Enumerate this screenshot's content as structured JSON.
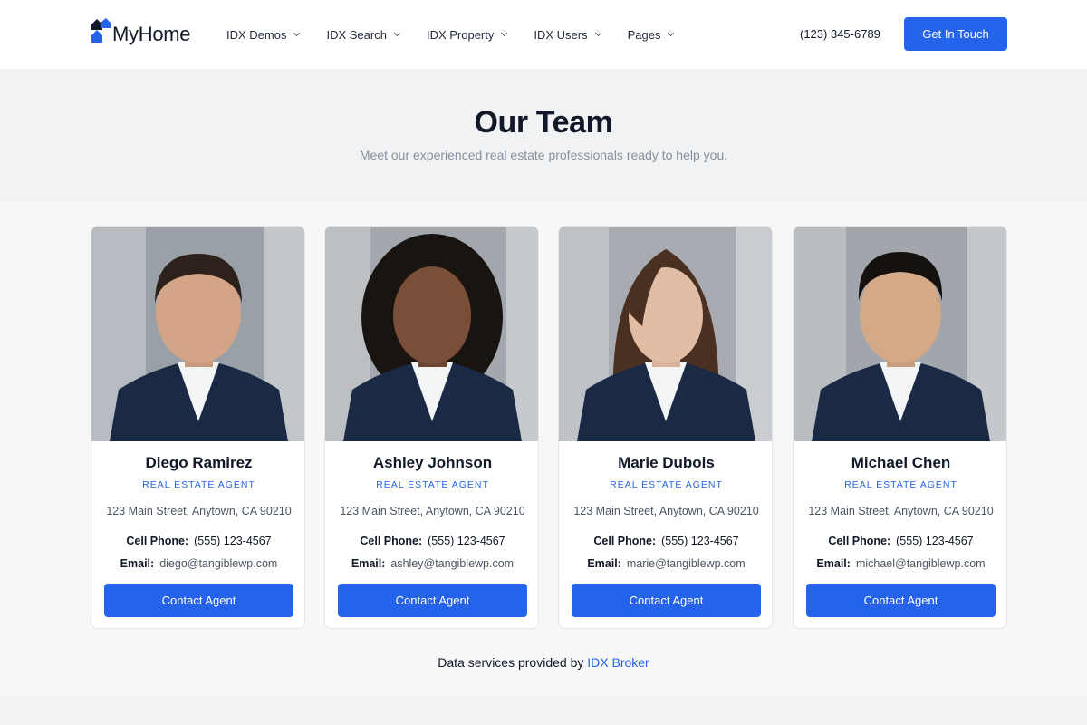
{
  "header": {
    "logo_text": "MyHome",
    "nav": [
      {
        "label": "IDX Demos"
      },
      {
        "label": "IDX Search"
      },
      {
        "label": "IDX Property"
      },
      {
        "label": "IDX Users"
      },
      {
        "label": "Pages"
      }
    ],
    "phone": "(123) 345-6789",
    "cta_label": "Get In Touch"
  },
  "hero": {
    "title": "Our Team",
    "subtitle": "Meet our experienced real estate professionals ready to help you."
  },
  "labels": {
    "cell_phone": "Cell Phone:",
    "email": "Email:",
    "contact_button": "Contact Agent"
  },
  "agents": [
    {
      "name": "Diego Ramirez",
      "role": "REAL ESTATE AGENT",
      "address": "123 Main Street, Anytown, CA 90210",
      "phone": "(555) 123-4567",
      "email": "diego@tangiblewp.com"
    },
    {
      "name": "Ashley Johnson",
      "role": "REAL ESTATE AGENT",
      "address": "123 Main Street, Anytown, CA 90210",
      "phone": "(555) 123-4567",
      "email": "ashley@tangiblewp.com"
    },
    {
      "name": "Marie Dubois",
      "role": "REAL ESTATE AGENT",
      "address": "123 Main Street, Anytown, CA 90210",
      "phone": "(555) 123-4567",
      "email": "marie@tangiblewp.com"
    },
    {
      "name": "Michael Chen",
      "role": "REAL ESTATE AGENT",
      "address": "123 Main Street, Anytown, CA 90210",
      "phone": "(555) 123-4567",
      "email": "michael@tangiblewp.com"
    }
  ],
  "footer": {
    "prefix": "Data services provided by",
    "link": "IDX Broker"
  },
  "colors": {
    "accent": "#2563eb",
    "hero_bg": "#f1f2f4",
    "suit": "#1b2a44"
  }
}
